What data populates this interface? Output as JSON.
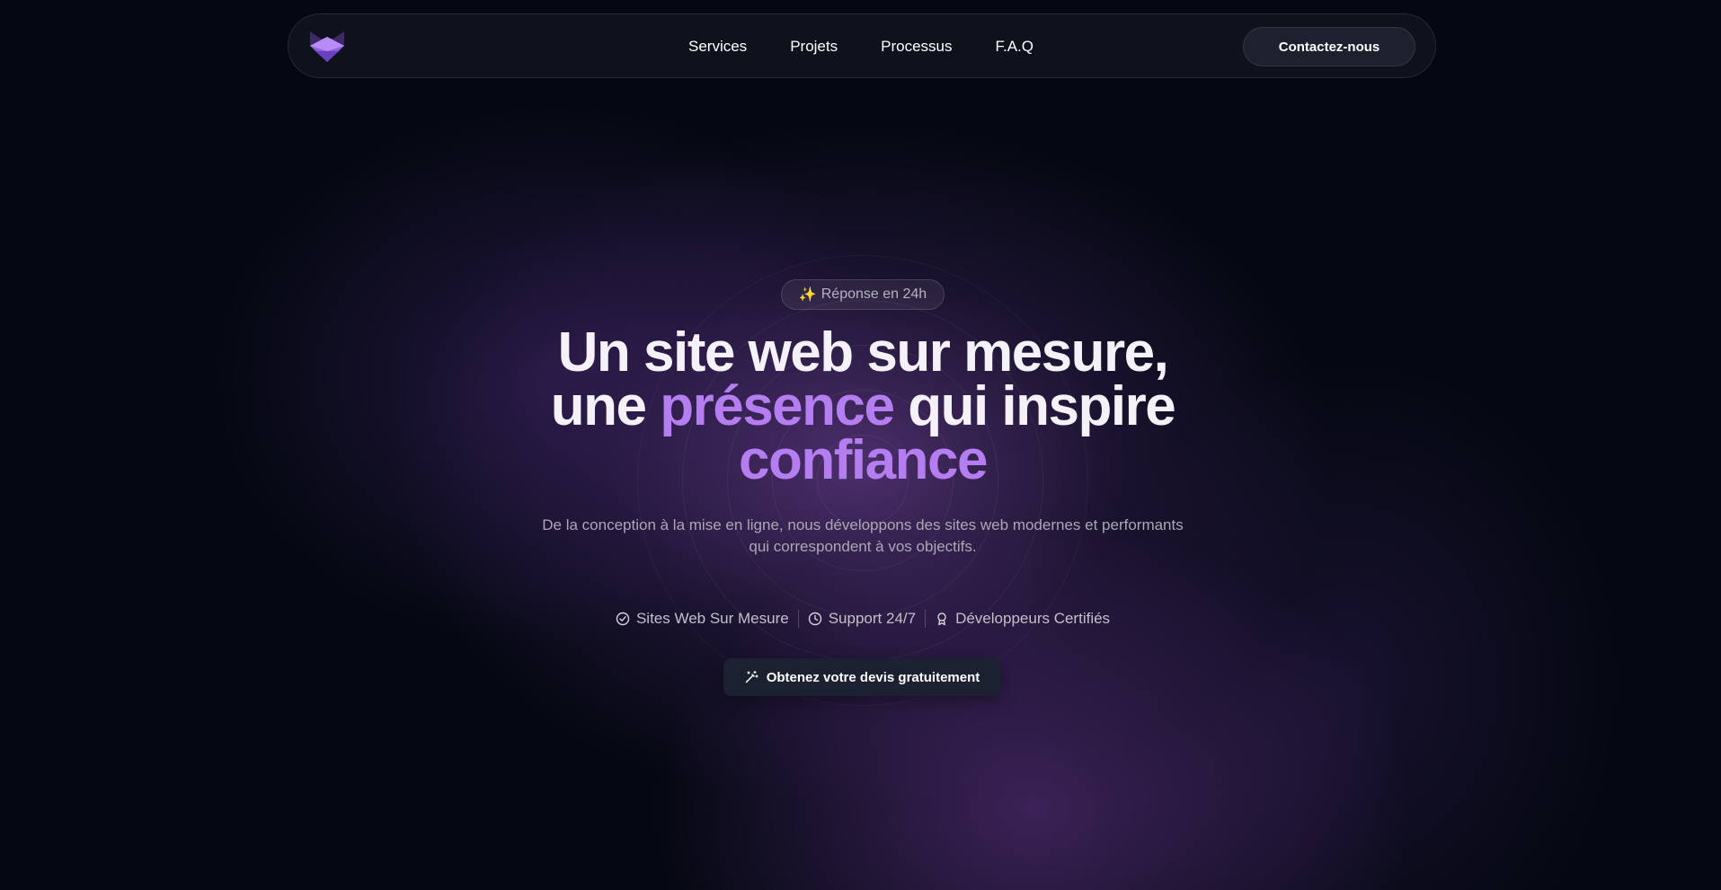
{
  "nav": {
    "items": [
      {
        "label": "Services"
      },
      {
        "label": "Projets"
      },
      {
        "label": "Processus"
      },
      {
        "label": "F.A.Q"
      }
    ],
    "contact_label": "Contactez-nous"
  },
  "hero": {
    "badge": {
      "icon": "sparkles-icon",
      "label": "Réponse en 24h"
    },
    "headline": {
      "line1": "Un site web sur mesure,",
      "line2_pre": "une ",
      "line2_accent": "présence",
      "line2_post": " qui inspire",
      "line3_accent": "confiance"
    },
    "subtitle": {
      "line1": "De la conception à la mise en ligne, nous développons des sites web modernes et performants",
      "line2": "qui correspondent à vos objectifs."
    },
    "features": [
      {
        "icon": "check-circle-icon",
        "label": "Sites Web Sur Mesure"
      },
      {
        "icon": "clock-icon",
        "label": "Support 24/7"
      },
      {
        "icon": "award-icon",
        "label": "Développeurs Certifiés"
      }
    ],
    "cta": {
      "icon": "magic-wand-icon",
      "label": "Obtenez votre devis gratuitement"
    }
  },
  "colors": {
    "background": "#050812",
    "accent": "#b57ef0",
    "glow": "#764aa0",
    "button": "#1b2130"
  }
}
